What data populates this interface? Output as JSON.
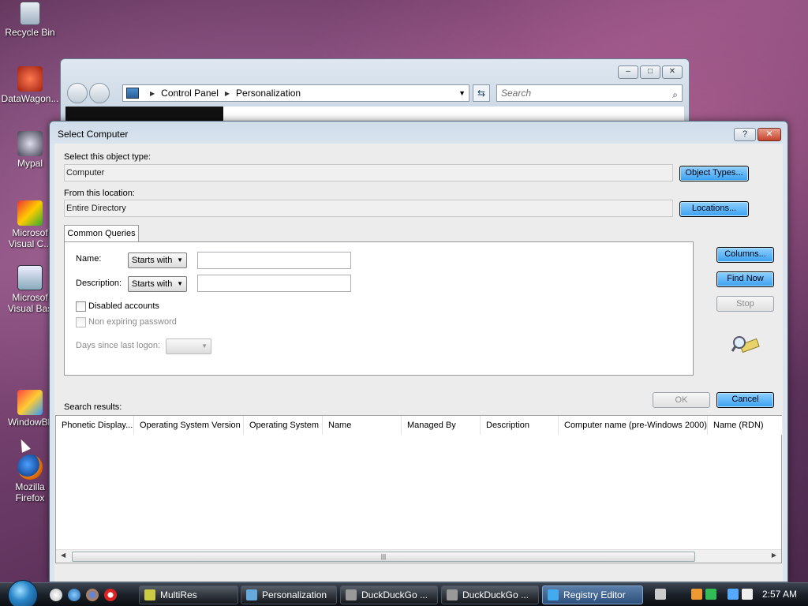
{
  "desktop": {
    "icons": [
      {
        "label": "Recycle Bin",
        "icon": "recycle-bin-icon"
      },
      {
        "label": "DataWagon...",
        "icon": "datawagon-icon"
      },
      {
        "label": "Mypal",
        "icon": "mypal-icon"
      },
      {
        "label": "Microsof Visual C...",
        "line1": "Microsof",
        "line2": "Visual C...",
        "icon": "visual-c-icon"
      },
      {
        "label": "Microsof Visual Bas",
        "line1": "Microsof",
        "line2": "Visual Bas",
        "icon": "visual-basic-icon"
      },
      {
        "label": "WindowBli",
        "icon": "windowblinds-icon"
      },
      {
        "label": "Mozilla Firefox",
        "line1": "Mozilla",
        "line2": "Firefox",
        "icon": "firefox-icon"
      }
    ]
  },
  "explorer": {
    "breadcrumb": [
      "Control Panel",
      "Personalization"
    ],
    "search_placeholder": "Search"
  },
  "dialog": {
    "title": "Select Computer",
    "help_label": "?",
    "close_label": "✕",
    "object_type_label": "Select this object type:",
    "object_type_value": "Computer",
    "object_types_button": "Object Types...",
    "location_label": "From this location:",
    "location_value": "Entire Directory",
    "locations_button": "Locations...",
    "tab_label": "Common Queries",
    "name_label": "Name:",
    "name_mode": "Starts with",
    "description_label": "Description:",
    "description_mode": "Starts with",
    "disabled_accounts_label": "Disabled accounts",
    "non_expiring_label": "Non expiring password",
    "days_since_label": "Days since last logon:",
    "columns_button": "Columns...",
    "find_now_button": "Find Now",
    "stop_button": "Stop",
    "ok_button": "OK",
    "cancel_button": "Cancel",
    "search_results_label": "Search results:",
    "columns": [
      "Phonetic Display...",
      "Operating System Version",
      "Operating System",
      "Name",
      "Managed By",
      "Description",
      "Computer name (pre-Windows 2000)",
      "Name (RDN)"
    ]
  },
  "taskbar": {
    "tasks": [
      {
        "label": "MultiRes",
        "active": false
      },
      {
        "label": "Personalization",
        "active": false
      },
      {
        "label": "DuckDuckGo ...",
        "active": false
      },
      {
        "label": "DuckDuckGo ...",
        "active": false
      },
      {
        "label": "Registry Editor",
        "active": true
      }
    ],
    "clock": "2:57 AM"
  },
  "colors": {
    "accent_button": "#3aa0f0",
    "close_button": "#c5422c",
    "active_task": "#2d4f7c"
  }
}
